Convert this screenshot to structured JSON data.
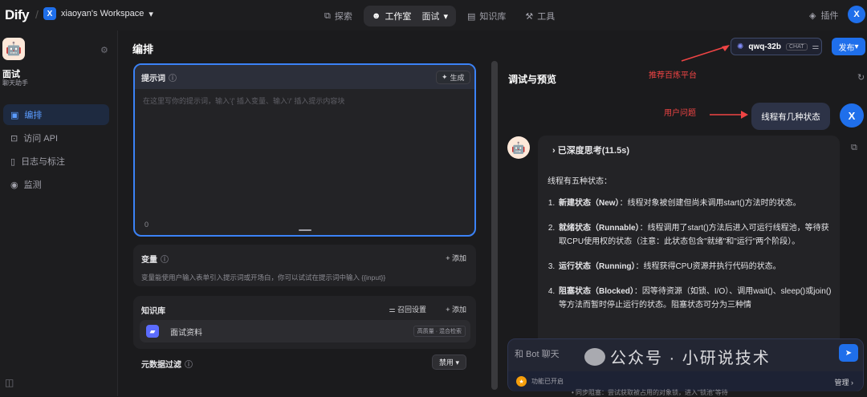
{
  "topbar": {
    "logo": "Dify",
    "workspace_badge": "X",
    "workspace_name": "xiaoyan's Workspace",
    "nav": [
      {
        "label": "探索",
        "icon": "compass-icon"
      },
      {
        "label": "工作室",
        "icon": "robot-icon",
        "active": true,
        "sub": "面试"
      },
      {
        "label": "知识库",
        "icon": "book-icon"
      },
      {
        "label": "工具",
        "icon": "wrench-icon"
      }
    ],
    "plugins_label": "插件",
    "user_initial": "X"
  },
  "sidebar": {
    "app_name": "面试",
    "app_type": "聊天助手",
    "items": [
      {
        "label": "编排",
        "active": true
      },
      {
        "label": "访问 API"
      },
      {
        "label": "日志与标注"
      },
      {
        "label": "监测"
      }
    ]
  },
  "editor": {
    "title": "编排",
    "prompt": {
      "label": "提示词",
      "generate_label": "生成",
      "placeholder": "在这里写你的提示词，输入'{' 插入变量、输入'/' 插入提示内容块",
      "char_count": "0"
    },
    "variables": {
      "label": "变量",
      "add_label": "+ 添加",
      "description": "变量能使用户输入表单引入提示词或开场白，你可以试试在提示词中输入 {{input}}"
    },
    "knowledge": {
      "label": "知识库",
      "recall_label": "召回设置",
      "add_label": "+ 添加",
      "item_name": "面试资料",
      "item_tag": "高质量 · 混合检索"
    },
    "metadata": {
      "label": "元数据过滤",
      "button_label": "禁用"
    }
  },
  "debug": {
    "model_name": "qwq-32b",
    "model_tag": "CHAT",
    "publish_label": "发布",
    "title": "调试与预览",
    "annotation_model": "推荐百炼平台",
    "annotation_question": "用户问题",
    "user_message": "线程有几种状态",
    "user_initial": "X",
    "thinking_label": "已深度思考(11.5s)",
    "answer_intro": "线程有五种状态：",
    "states": [
      {
        "title": "新建状态（New）",
        "text": "：线程对象被创建但尚未调用start()方法时的状态。"
      },
      {
        "title": "就绪状态（Runnable）",
        "text": "：线程调用了start()方法后进入可运行线程池，等待获取CPU使用权的状态（注意：此状态包含\"就绪\"和\"运行\"两个阶段）。"
      },
      {
        "title": "运行状态（Running）",
        "text": "：线程获得CPU资源并执行代码的状态。"
      },
      {
        "title": "阻塞状态（Blocked）",
        "text": "：因等待资源（如锁、I/O）、调用wait()、sleep()或join()等方法而暂时停止运行的状态。阻塞状态可分为三种情"
      }
    ],
    "input_placeholder": "和 Bot 聊天",
    "feature_label": "功能已开启",
    "manage_label": "管理",
    "peek_text": "• 同步阻塞：尝试获取被占用的对象锁，进入\"锁池\"等待"
  },
  "watermark": "公众号 · 小研说技术"
}
